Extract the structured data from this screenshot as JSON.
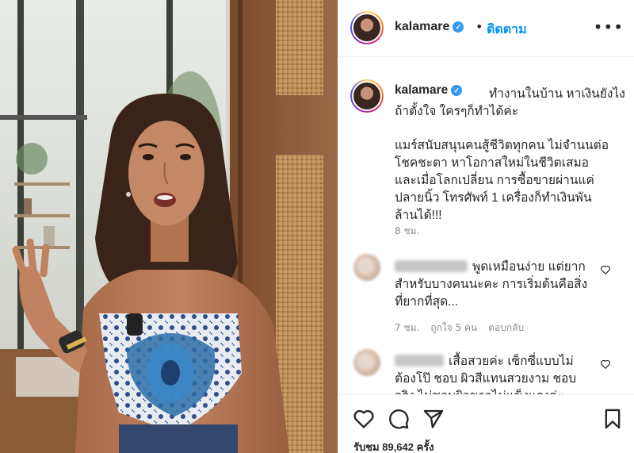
{
  "post": {
    "username": "kalamare",
    "follow_label": "ติดตาม",
    "header_separator": "•",
    "more_icon": "more-horizontal-icon",
    "verified_icon": "verified-badge-icon"
  },
  "caption": {
    "username": "kalamare",
    "line1": "ทำงานในบ้าน หาเงินยังไง",
    "line2": "ถ้าตั้งใจ ใครๆก็ทำได้ค่ะ",
    "line3": "แมร์สนับสนุนคนสู้ชีวิตทุกคน ไม่จำนนต่อ",
    "line4": "โชคชะตา หาโอกาสใหม่ในชีวิตเสมอ",
    "line5": "และเมื่อโลกเปลี่ยน การซื้อขายผ่านแค่",
    "line6": "ปลายนิ้ว โทรศัพท์ 1 เครื่องก็ทำเงินพัน",
    "line7": "ล้านได้!!!",
    "time": "8 ชม."
  },
  "comments": [
    {
      "line1": "พูดเหมือนง่าย แต่ยาก",
      "line2": "สำหรับบางคนนะคะ การเริ่มต้นคือสิ่ง",
      "line3": "ที่ยากที่สุด...",
      "time": "7 ชม.",
      "likes": "ถูกใจ 5 คน",
      "reply": "ตอบกลับ"
    },
    {
      "line1": "เสื้อสวยค่ะ เซ็กซี่แบบไม่",
      "line2": "ต้องโป๊ ชอบ ผิวสีแทนสวยงาม ชอบ",
      "line3": "จริง ไม่ชอบผิวขาวไม่แข็งแรงค่ะ"
    }
  ],
  "actions": {
    "like_icon": "heart-icon",
    "comment_icon": "comment-icon",
    "share_icon": "paper-plane-icon",
    "save_icon": "bookmark-icon"
  },
  "stats": {
    "views": "รับชม 89,642 ครั้ง"
  },
  "colors": {
    "accent": "#0095f6",
    "verified": "#3897f0",
    "muted": "#8e8e8e",
    "text": "#262626"
  }
}
